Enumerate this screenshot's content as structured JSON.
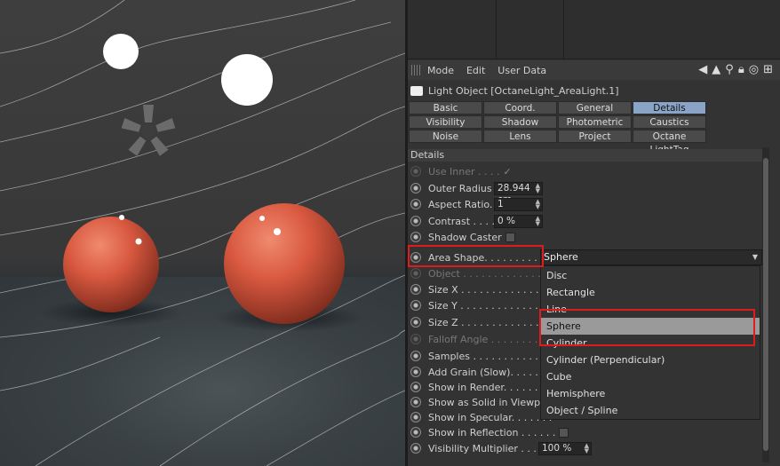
{
  "menubar": {
    "items": [
      "Mode",
      "Edit",
      "User Data"
    ]
  },
  "object_title": "Light Object [OctaneLight_AreaLight.1]",
  "tabs": [
    "Basic",
    "Coord.",
    "General",
    "Details",
    "Visibility",
    "Shadow",
    "Photometric",
    "Caustics",
    "Noise",
    "Lens",
    "Project",
    "Octane LightTag"
  ],
  "active_tab": "Details",
  "section_title": "Details",
  "rows": {
    "use_inner": "Use Inner . . . .",
    "use_inner_check": "✓",
    "outer_radius": "Outer Radius",
    "outer_radius_val": "28.944 cm",
    "aspect_ratio": "Aspect Ratio. .",
    "aspect_ratio_val": "1",
    "contrast": "Contrast . . . . .",
    "contrast_val": "0 %",
    "shadow_caster": "Shadow Caster",
    "area_shape": "Area Shape. . . . . . . . . . . .",
    "object": "Object . . . . . . . . . . . . . .",
    "size_x": "Size X . . . . . . . . . . . . . .",
    "size_y": "Size Y . . . . . . . . . . . . . .",
    "size_z": "Size Z . . . . . . . . . . . . . .",
    "falloff_angle": "Falloff Angle . . . . . . . . .",
    "samples": "Samples . . . . . . . . . . . .",
    "add_grain": "Add Grain (Slow). . . . . . .",
    "show_in_render": "Show in Render. . . . . . . .",
    "show_as_solid": "Show as Solid in Viewport",
    "show_in_specular": "Show in Specular. . . . . . .",
    "show_in_reflection": "Show in Reflection . . . . . .",
    "visibility_multiplier": "Visibility Multiplier . . . . .",
    "visibility_multiplier_val": "100 %"
  },
  "area_shape_value": "Sphere",
  "area_shape_options": [
    "Disc",
    "Rectangle",
    "Line",
    "Sphere",
    "Cylinder",
    "Cylinder (Perpendicular)",
    "Cube",
    "Hemisphere",
    "Object / Spline"
  ],
  "selected_option": "Sphere",
  "colors": {
    "active_tab": "#8aa4c8",
    "highlight": "#e01b1b",
    "sphere": "#d8583f"
  }
}
